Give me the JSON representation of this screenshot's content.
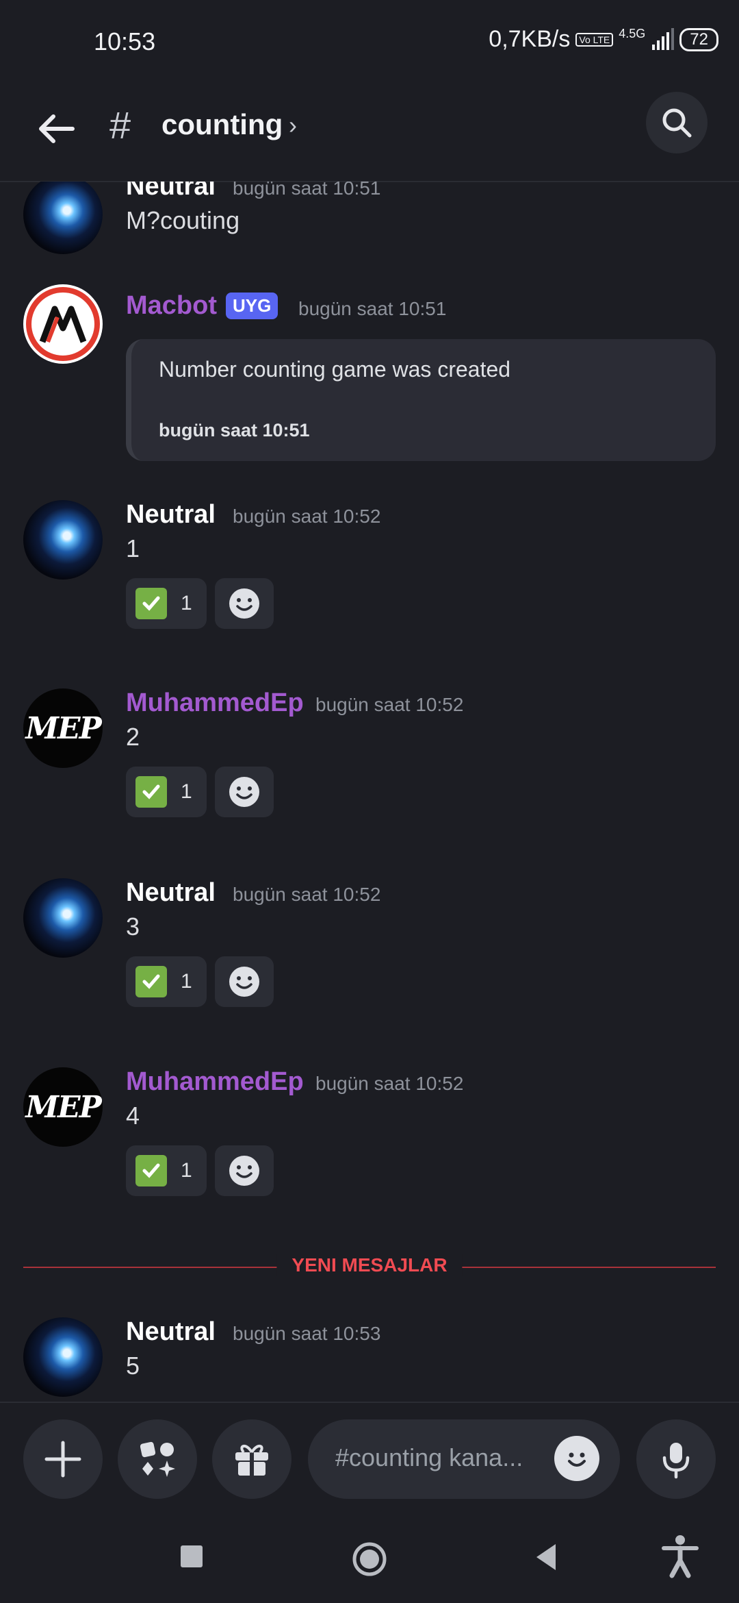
{
  "status_bar": {
    "time": "10:53",
    "net_speed": "0,7KB/s",
    "volte": "Vo LTE",
    "network_gen": "4.5G",
    "battery": "72"
  },
  "header": {
    "channel_name": "counting",
    "hash_symbol": "#",
    "chevron": "›"
  },
  "messages": [
    {
      "author": "Neutral",
      "author_color": "#ffffff",
      "avatar": "galaxy",
      "timestamp": "bugün saat 10:51",
      "content": "M?couting"
    },
    {
      "author": "Macbot",
      "author_color": "#a35ad0",
      "avatar": "macbot-logo",
      "badge": "UYG",
      "timestamp": "bugün saat 10:51",
      "embed": {
        "title": "Number counting game was created",
        "footer": "bugün saat 10:51"
      }
    },
    {
      "author": "Neutral",
      "author_color": "#ffffff",
      "avatar": "galaxy",
      "timestamp": "bugün saat 10:52",
      "content": "1",
      "reaction": {
        "emoji": "white-check-mark",
        "count": "1"
      }
    },
    {
      "author": "MuhammedEp",
      "author_color": "#a35ad0",
      "avatar": "mep-logo",
      "avatar_text": "MEP",
      "timestamp": "bugün saat 10:52",
      "content": "2",
      "reaction": {
        "emoji": "white-check-mark",
        "count": "1"
      }
    },
    {
      "author": "Neutral",
      "author_color": "#ffffff",
      "avatar": "galaxy",
      "timestamp": "bugün saat 10:52",
      "content": "3",
      "reaction": {
        "emoji": "white-check-mark",
        "count": "1"
      }
    },
    {
      "author": "MuhammedEp",
      "author_color": "#a35ad0",
      "avatar": "mep-logo",
      "avatar_text": "MEP",
      "timestamp": "bugün saat 10:52",
      "content": "4",
      "reaction": {
        "emoji": "white-check-mark",
        "count": "1"
      }
    },
    {
      "author": "Neutral",
      "author_color": "#ffffff",
      "avatar": "galaxy",
      "timestamp": "bugün saat 10:53",
      "content": "5"
    }
  ],
  "new_messages_divider": "YENI MESAJLAR",
  "composer": {
    "placeholder": "#counting kana..."
  },
  "colors": {
    "background": "#1c1d23",
    "accent_badge": "#5865f2",
    "divider_red": "#f04b52",
    "role_purple": "#a35ad0"
  }
}
